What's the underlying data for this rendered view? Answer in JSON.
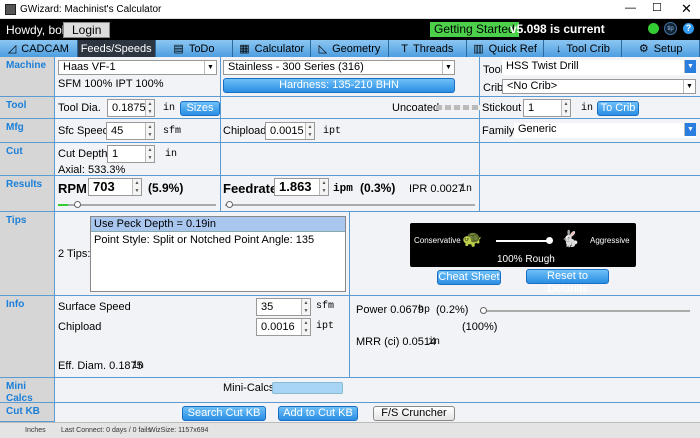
{
  "window": {
    "title": "GWizard: Machinist's Calculator"
  },
  "header": {
    "greeting": "Howdy, bob!",
    "login": "Login",
    "getting_started": "Getting Started",
    "version": "v5.098 is current"
  },
  "tabs": [
    {
      "label": "CADCAM"
    },
    {
      "label": "Feeds/Speeds"
    },
    {
      "label": "ToDo"
    },
    {
      "label": "Calculator"
    },
    {
      "label": "Geometry"
    },
    {
      "label": "Threads"
    },
    {
      "label": "Quick Ref"
    },
    {
      "label": "Tool Crib"
    },
    {
      "label": "Setup"
    }
  ],
  "sections": {
    "machine": "Machine",
    "tool": "Tool",
    "mfg": "Mfg",
    "cut": "Cut",
    "results": "Results",
    "tips": "Tips",
    "info": "Info",
    "mini": "Mini Calcs",
    "cutkb": "Cut KB"
  },
  "machine": {
    "value": "Haas VF-1",
    "factors": "SFM 100% IPT 100%",
    "material": "Stainless - 300 Series (316)",
    "hardness": "Hardness: 135-210 BHN",
    "tool_label": "Tool",
    "tool": "HSS Twist Drill",
    "crib_label": "Crib",
    "crib": "<No Crib>"
  },
  "tool": {
    "dia_label": "Tool Dia.",
    "dia": "0.1875",
    "unit": "in",
    "sizes": "Sizes",
    "coating": "Uncoated",
    "stickout_label": "Stickout",
    "stickout": "1",
    "stickout_unit": "in",
    "to_crib": "To Crib"
  },
  "mfg": {
    "sfc_label": "Sfc Speed",
    "sfc": "45",
    "sfc_unit": "sfm",
    "chip_label": "Chipload",
    "chip": "0.0015",
    "chip_unit": "ipt",
    "family_label": "Family:",
    "family": "Generic"
  },
  "cut": {
    "depth_label": "Cut Depth",
    "depth": "1",
    "unit": "in",
    "axial": "Axial: 533.3%"
  },
  "results": {
    "rpm_label": "RPM",
    "rpm": "703",
    "rpm_pct": "(5.9%)",
    "feed_label": "Feedrate",
    "feed": "1.863",
    "feed_unit": "ipm",
    "feed_pct": "(0.3%)",
    "ipr": "IPR 0.0027",
    "ipr_unit": "in",
    "rpm_slider": 0.059,
    "feed_slider": 0.003
  },
  "tips": {
    "count": "2 Tips:",
    "items": [
      "Use Peck Depth = 0.19in",
      "Point Style: Split or Notched Point Angle: 135"
    ],
    "conservative": "Conservative",
    "aggressive": "Aggressive",
    "aggr_value": "100% Rough",
    "cheat": "Cheat Sheet",
    "reset": "Reset to Defaults"
  },
  "info": {
    "ss_label": "Surface Speed",
    "ss": "35",
    "ss_unit": "sfm",
    "cl_label": "Chipload",
    "cl": "0.0016",
    "cl_unit": "ipt",
    "eff": "Eff. Diam. 0.1875",
    "eff_unit": "in",
    "power": "Power 0.0679",
    "power_unit": "hp",
    "power_pct": "(0.2%)",
    "power_max": "(100%)",
    "mrr": "MRR (ci) 0.0514",
    "mrr_unit": "in",
    "power_slider": 0.002
  },
  "mini": {
    "label": "Mini-Calcs"
  },
  "cutkb": {
    "search": "Search Cut KB",
    "add": "Add to Cut KB",
    "cruncher": "F/S Cruncher"
  },
  "status": {
    "units": "Inches",
    "connect": "Last Connect: 0 days / 0 fails",
    "size": "WizSize: 1157x694"
  }
}
